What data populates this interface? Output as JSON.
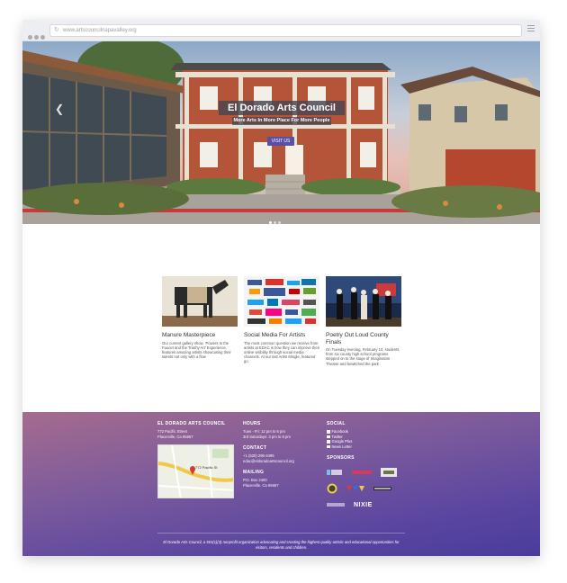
{
  "browser": {
    "url": "www.artscouncilnapavalley.org"
  },
  "hero": {
    "title": "El Dorado Arts Council",
    "subtitle": "More Arts In More Place For More People",
    "cta_label": "VISIT US",
    "prev_icon": "chevron-left-icon"
  },
  "cards": [
    {
      "title": "Manure Masterpiece",
      "text": "Our current gallery show, 'Powers In the Faucet and the Trashy Art' Experience, features amazing artists showcasing their talents not only with a flow"
    },
    {
      "title": "Social Media For Artists",
      "text": "The most common question we receive from artists at EDAC is how they can improve their online visibility through social media channels. At our last Artist Mingle, featured go"
    },
    {
      "title": "Poetry Out Loud County Finals",
      "text": "On Tuesday evening, February 10, students from six county high school programs stepped on to the stage of Imagination Theater and bewitched the park"
    }
  ],
  "footer": {
    "org": {
      "heading": "EL DORADO ARTS COUNCIL",
      "line1": "772 Pacific Street",
      "line2": "Placerville, Ca 95667"
    },
    "map": {
      "label": "772 Pacific St"
    },
    "hours": {
      "heading": "HOURS",
      "line1": "Tues - Fri: 12 pm to 6 pm",
      "line2": "3rd Saturdays: 3 pm to 8 pm"
    },
    "contact": {
      "heading": "CONTACT",
      "line1": "+1 (530) 295-3496",
      "line2": "edac@eldoradoartscouncil.org"
    },
    "mailing": {
      "heading": "MAILING",
      "line1": "P.O. Box 2400",
      "line2": "Placerville, Ca 95667"
    },
    "social": {
      "heading": "SOCIAL",
      "items": [
        "Facebook",
        "Twitter",
        "Google Plus",
        "News Letter"
      ]
    },
    "sponsors": {
      "heading": "SPONSORS",
      "nixie": "NIXIE"
    },
    "note": "El Dorado Arts Council, a 501(c)(3) nonprofit organization advocating and creating the highest quality artistic and educational opportunities for visitors, residents and children."
  },
  "colors": {
    "accent": "#5a4fa6",
    "footer_top": "#a56c8e",
    "footer_bottom": "#4a3c9c"
  }
}
